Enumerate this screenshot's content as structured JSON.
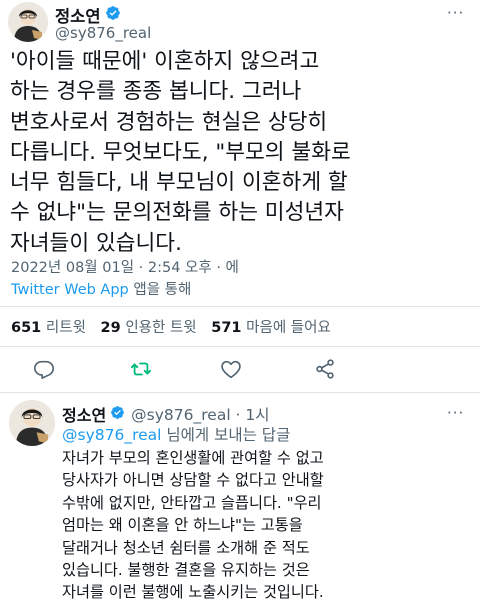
{
  "main_tweet": {
    "author_name": "정소연",
    "author_handle": "@sy876_real",
    "text_lines": [
      "'아이들 때문에' 이혼하지 않으려고",
      "하는 경우를 종종 봅니다. 그러나",
      "변호사로서 경험하는 현실은 상당히",
      "다릅니다. 무엇보다도, \"부모의 불화로",
      "너무 힘들다, 내 부모님이 이혼하게 할",
      "수 없냐\"는 문의전화를 하는 미성년자",
      "자녀들이 있습니다."
    ],
    "timestamp": "2022년 08월 01일 · 2:54 오후 · 에",
    "app_name": "Twitter Web App",
    "app_suffix": " 앱을 통해",
    "stats": {
      "retweets_count": "651",
      "retweets_label": "리트윗",
      "quotes_count": "29",
      "quotes_label": "인용한 트윗",
      "likes_count": "571",
      "likes_label": "마음에 들어요"
    },
    "actions": [
      "reply-icon",
      "retweet-icon",
      "like-icon",
      "share-icon"
    ]
  },
  "reply_tweet": {
    "author_name": "정소연",
    "author_handle": "@sy876_real · 1시",
    "replying_mention": "@sy876_real",
    "replying_suffix": " 님에게 보내는 답글",
    "text_lines": [
      "자녀가 부모의 혼인생활에 관여할 수 없고",
      "당사자가 아니면 상담할 수 없다고 안내할",
      "수밖에 없지만, 안타깝고 슬픕니다. \"우리",
      "엄마는 왜 이혼을 안 하느냐\"는 고통을",
      "달래거나 청소년 쉼터를 소개해 준 적도",
      "있습니다. 불행한 결혼을 유지하는 것은",
      "자녀를 이런 불행에 노출시키는 것입니다."
    ]
  },
  "colors": {
    "accent_blue": "#1d9bf0",
    "retweet_green": "#00ba7c",
    "text_primary": "#0f1419",
    "text_secondary": "#536471"
  }
}
